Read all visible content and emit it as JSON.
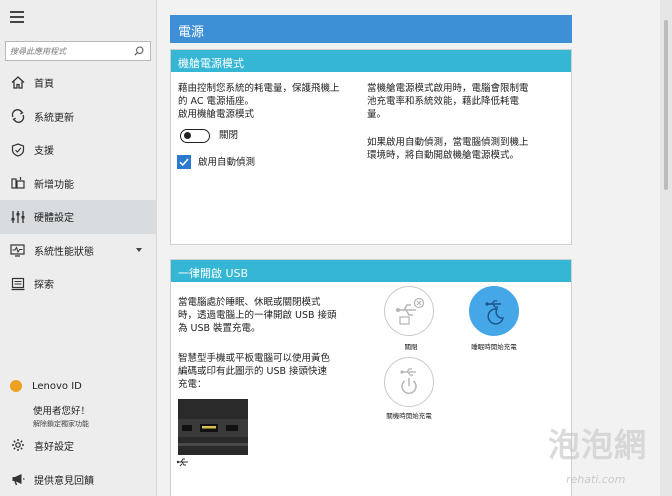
{
  "sidebar": {
    "search_placeholder": "搜尋此應用程式",
    "items": [
      {
        "label": "首頁",
        "icon": "home-icon"
      },
      {
        "label": "系統更新",
        "icon": "update-icon"
      },
      {
        "label": "支援",
        "icon": "support-icon"
      },
      {
        "label": "新增功能",
        "icon": "new-features-icon"
      },
      {
        "label": "硬體設定",
        "icon": "hardware-settings-icon",
        "active": true
      },
      {
        "label": "系統性能狀態",
        "icon": "system-health-icon",
        "has_dropdown": true
      },
      {
        "label": "探索",
        "icon": "discover-icon"
      }
    ],
    "lenovo_id": {
      "title": "Lenovo ID",
      "greeting": "使用者您好！",
      "unlink": "解除鎖定獨家功能"
    },
    "preferences_label": "喜好設定",
    "feedback_label": "提供意見回饋"
  },
  "page": {
    "title": "電源"
  },
  "airplane_power": {
    "title": "機艙電源模式",
    "description_line1": "藉由控制您系統的耗電量，保護飛機上",
    "description_line2": "的 AC 電源插座。",
    "enable_label": "啟用機艙電源模式",
    "toggle_state": "關閉",
    "auto_detect_label": "啟用自動偵測",
    "auto_detect_checked": true,
    "right_text_1_line1": "當機艙電源模式啟用時，電腦會限制電",
    "right_text_1_line2": "池充電率和系統效能，藉此降低耗電",
    "right_text_1_line3": "量。",
    "right_text_2_line1": "如果啟用自動偵測，當電腦偵測到機上",
    "right_text_2_line2": "環境時，將自動開啟機艙電源模式。"
  },
  "always_on_usb": {
    "title": "一律開啟 USB",
    "description_line1": "當電腦處於睡眠、休眠或關閉模式",
    "description_line2": "時，透過電腦上的一律開啟 USB 接頭",
    "description_line3": "為 USB 裝置充電。",
    "phone_line1": "智慧型手機或平板電腦可以使用黃色",
    "phone_line2": "編碼或印有此圖示的 USB 接頭快速",
    "phone_line3": "充電：",
    "options": [
      {
        "label": "關閉",
        "icon": "usb-off-icon",
        "selected": false
      },
      {
        "label": "睡眠時開始充電",
        "icon": "usb-sleep-charge-icon",
        "selected": true
      },
      {
        "label": "關機時開始充電",
        "icon": "usb-power-off-charge-icon",
        "selected": false
      }
    ]
  },
  "watermark": {
    "text": "泡泡網",
    "sub": "rehati.com"
  },
  "colors": {
    "header_blue": "#3d8fd6",
    "card_bar_cyan": "#35b6d4",
    "selected_blue": "#45a6e8",
    "checkbox_blue": "#2b79d1"
  }
}
